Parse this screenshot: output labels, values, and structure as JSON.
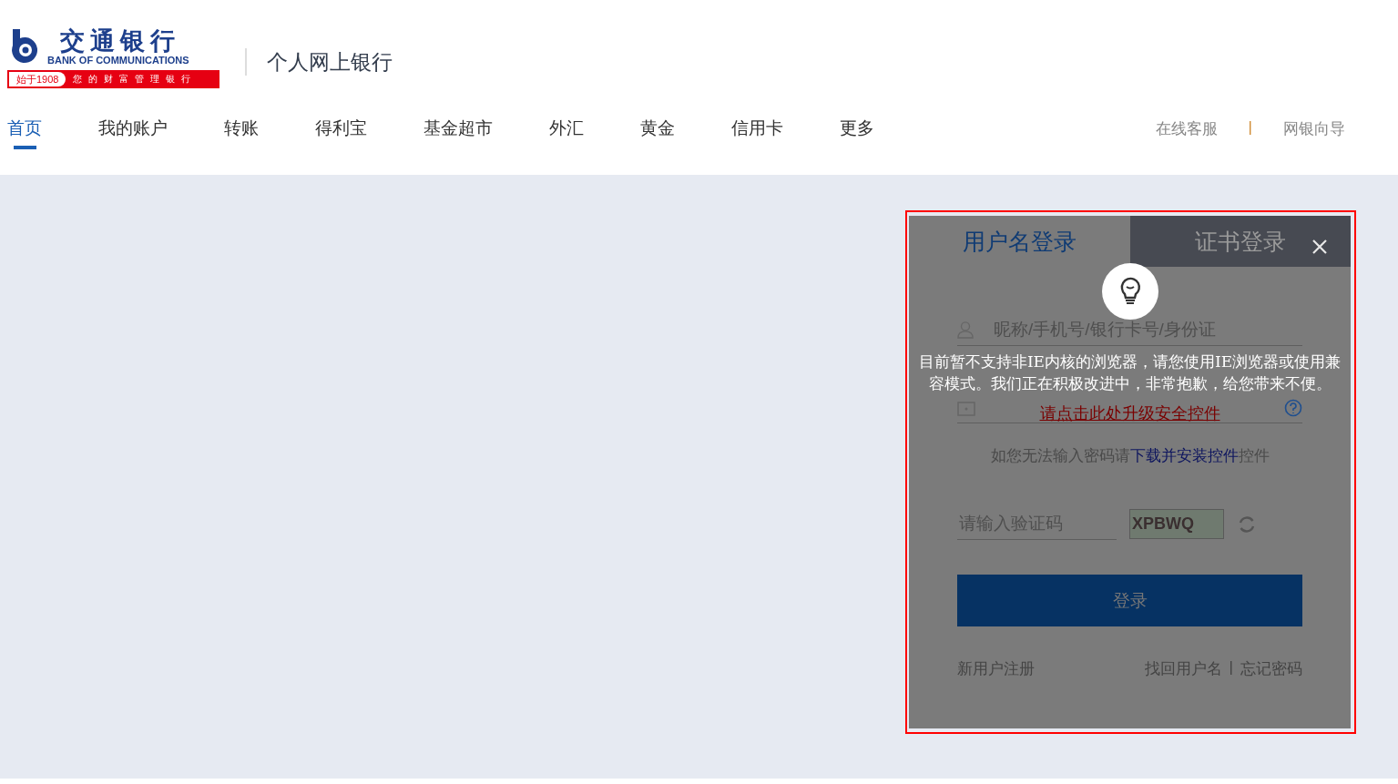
{
  "header": {
    "logo": {
      "name": "交通银行",
      "english": "BANK OF COMMUNICATIONS",
      "since": "始于1908",
      "slogan": "您的财富管理银行"
    },
    "product": "个人网上银行"
  },
  "nav": [
    {
      "label": "首页",
      "selected": true
    },
    {
      "label": "我的账户",
      "selected": false
    },
    {
      "label": "转账",
      "selected": false
    },
    {
      "label": "得利宝",
      "selected": false
    },
    {
      "label": "基金超市",
      "selected": false
    },
    {
      "label": "外汇",
      "selected": false
    },
    {
      "label": "黄金",
      "selected": false
    },
    {
      "label": "信用卡",
      "selected": false
    },
    {
      "label": "更多",
      "selected": false
    }
  ],
  "top_links": {
    "items": [
      "在线客服",
      "网银向导"
    ],
    "separator": "|"
  },
  "login": {
    "tabs": [
      {
        "label": "用户名登录",
        "selected": true
      },
      {
        "label": "证书登录",
        "selected": false
      }
    ],
    "username": {
      "placeholder": "昵称/手机号/银行卡号/身份证"
    },
    "password": {
      "upgrade_link": "请点击此处升级安全控件"
    },
    "hint": {
      "before": "如您无法输入密码请",
      "link": "下载并安装控件",
      "after": "控件"
    },
    "captcha": {
      "placeholder": "请输入验证码",
      "image_text": "XPBWQ"
    },
    "submit": "登录",
    "register": "新用户注册",
    "recover": [
      "找回用户名",
      "忘记密码"
    ],
    "recover_separator": "|"
  },
  "notice": {
    "message": "目前暂不支持非IE内核的浏览器，请您使用IE浏览器或使用兼容模式。我们正在积极改进中，非常抱歉，给您带来不便。"
  }
}
